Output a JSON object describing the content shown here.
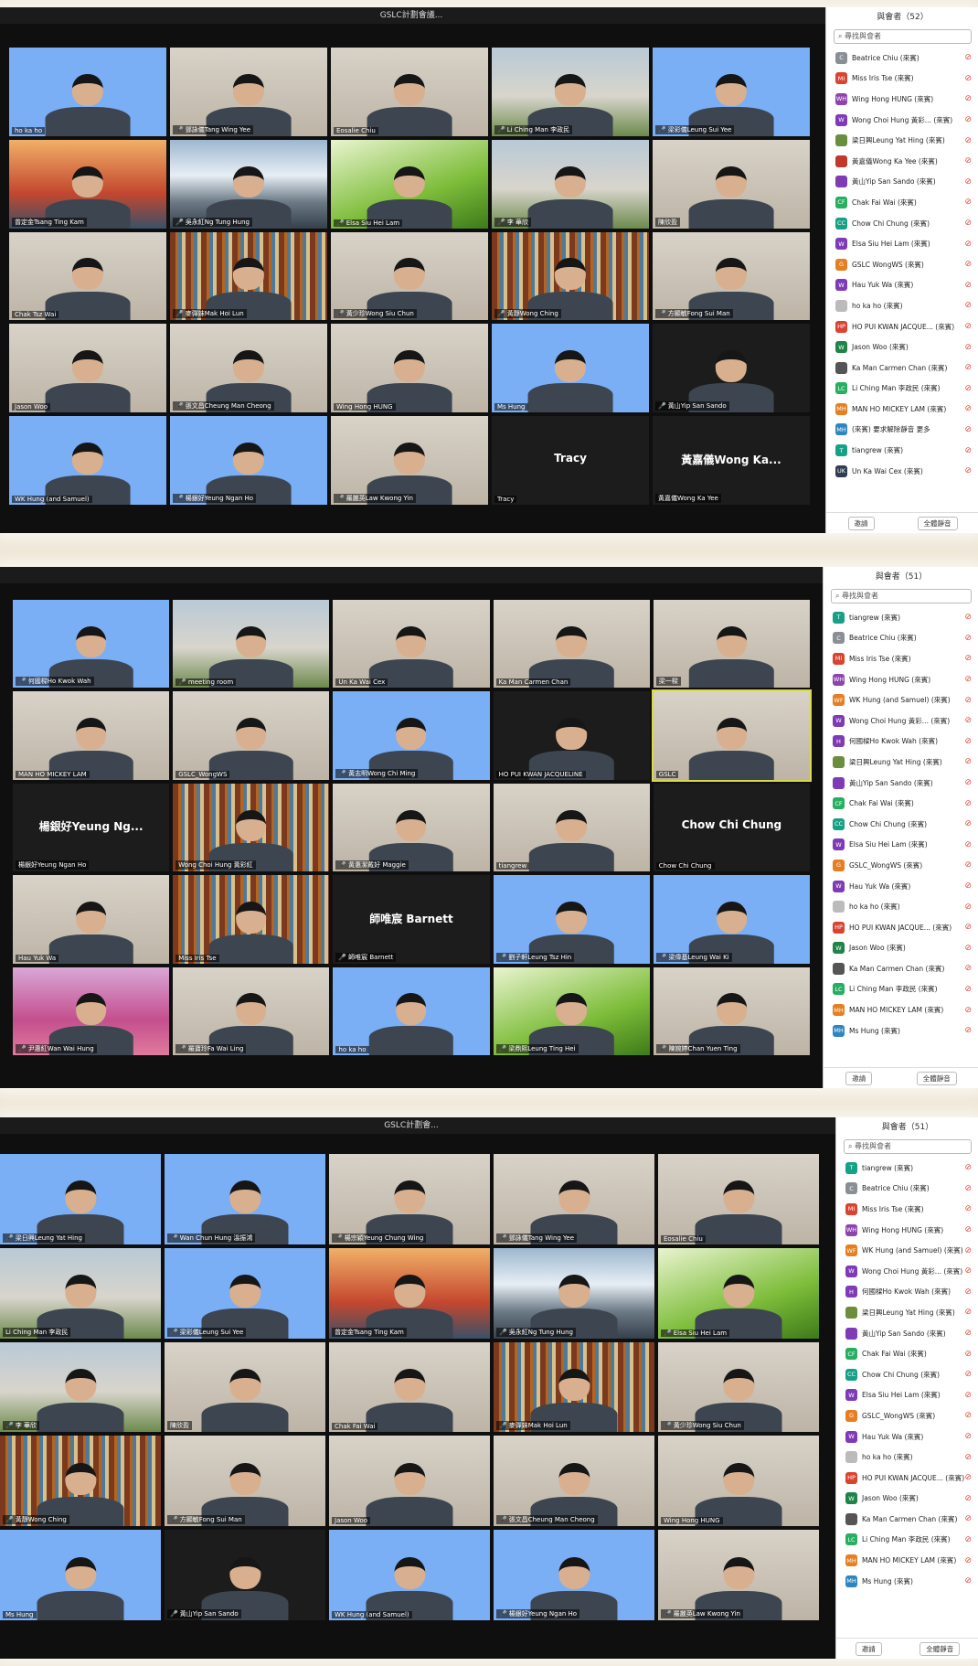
{
  "screens": [
    {
      "window_title": "GSLC計劃會議...",
      "toolbar_label": "",
      "participants_count_title": "與會者（52）",
      "search_placeholder": "尋找與會者",
      "footer": [
        "邀請",
        "全體靜音"
      ],
      "tiles": [
        {
          "name": "ho ka ho",
          "bg": "blue",
          "muted": false
        },
        {
          "name": "鄧詠儀Tang Wing Yee",
          "bg": "room",
          "muted": true
        },
        {
          "name": "Eosalie Chiu",
          "bg": "room",
          "muted": false
        },
        {
          "name": "Li Ching Man 李政民",
          "bg": "city",
          "muted": true
        },
        {
          "name": "梁彩儀Leung Sui Yee",
          "bg": "blue",
          "muted": true
        },
        {
          "name": "曾定金Tsang Ting Kam",
          "bg": "bridge",
          "muted": false
        },
        {
          "name": "吳永紅Ng Tung Hung",
          "bg": "mount",
          "muted": true
        },
        {
          "name": "Elsa Siu Hei Lam",
          "bg": "grass",
          "muted": true
        },
        {
          "name": "李 華欣",
          "bg": "city",
          "muted": true
        },
        {
          "name": "陳欣盈",
          "bg": "room",
          "muted": false
        },
        {
          "name": "Chak Tsz Wai",
          "bg": "room",
          "muted": false
        },
        {
          "name": "麥彈妹Mak Hoi Lun",
          "bg": "book",
          "muted": true
        },
        {
          "name": "黃少珍Wong Siu Chun",
          "bg": "room",
          "muted": true
        },
        {
          "name": "黃靜Wong Ching",
          "bg": "book",
          "muted": true
        },
        {
          "name": "方顯敏Fong Sui Man",
          "bg": "room",
          "muted": true
        },
        {
          "name": "Jason Woo",
          "bg": "room",
          "muted": false
        },
        {
          "name": "張文昌Cheung Man Cheong",
          "bg": "room",
          "muted": true
        },
        {
          "name": "Wing Hong HUNG",
          "bg": "room",
          "muted": false
        },
        {
          "name": "Ms Hung",
          "bg": "blue",
          "muted": false
        },
        {
          "name": "黃山Yip San Sando",
          "bg": "dark",
          "muted": true
        },
        {
          "name": "WK Hung (and Samuel)",
          "bg": "blue",
          "muted": false
        },
        {
          "name": "楊銀好Yeung Ngan Ho",
          "bg": "blue",
          "muted": true
        },
        {
          "name": "羅麗英Law Kwong Yin",
          "bg": "room",
          "muted": true
        },
        {
          "name": "Tracy",
          "bg": "dark",
          "muted": false,
          "big": "Tracy"
        },
        {
          "name": "黃嘉儀Wong Ka Yee",
          "bg": "dark",
          "muted": false,
          "big": "黃嘉儀Wong  Ka..."
        }
      ],
      "participants": [
        {
          "init": "C",
          "color": "#8a8f96",
          "name": "Beatrice Chiu (來賓)"
        },
        {
          "init": "MI",
          "color": "#d9432f",
          "name": "Miss Iris Tse (來賓)"
        },
        {
          "init": "WH",
          "color": "#8e44ad",
          "name": "Wing Hong HUNG (來賓)"
        },
        {
          "init": "W",
          "color": "#7e3bb5",
          "name": "Wong Choi Hung 黃彩... (來賓)"
        },
        {
          "init": "",
          "color": "#6b8e3c",
          "name": "梁日興Leung Yat Hing (來賓)"
        },
        {
          "init": "",
          "color": "#c0392b",
          "name": "黃嘉儀Wong Ka Yee (來賓)"
        },
        {
          "init": "",
          "color": "#7e3bb5",
          "name": "黃山Yip San Sando (來賓)"
        },
        {
          "init": "CF",
          "color": "#27ae60",
          "name": "Chak Fai Wai (來賓)"
        },
        {
          "init": "CC",
          "color": "#16a085",
          "name": "Chow Chi Chung (來賓)"
        },
        {
          "init": "W",
          "color": "#7e3bb5",
          "name": "Elsa Siu Hei Lam (來賓)"
        },
        {
          "init": "G",
          "color": "#e67e22",
          "name": "GSLC WongWS (來賓)"
        },
        {
          "init": "W",
          "color": "#7e3bb5",
          "name": "Hau Yuk Wa (來賓)"
        },
        {
          "init": "",
          "color": "#bbbbbb",
          "name": "ho ka ho (來賓)"
        },
        {
          "init": "HP",
          "color": "#d9432f",
          "name": "HO PUI KWAN JACQUE... (來賓)"
        },
        {
          "init": "W",
          "color": "#1e8449",
          "name": "Jason Woo (來賓)"
        },
        {
          "init": "",
          "color": "#555555",
          "name": "Ka Man Carmen Chan (來賓)"
        },
        {
          "init": "LC",
          "color": "#27ae60",
          "name": "Li Ching Man 李政民 (來賓)"
        },
        {
          "init": "MH",
          "color": "#e67e22",
          "name": "MAN HO MICKEY LAM (來賓)"
        },
        {
          "init": "MH",
          "color": "#2e86c1",
          "name": "(來賓)  要求解除靜音  更多"
        },
        {
          "init": "T",
          "color": "#16a085",
          "name": "tiangrew (來賓)"
        },
        {
          "init": "UK",
          "color": "#2c3e50",
          "name": "Un Ka Wai Cex (來賓)"
        }
      ]
    },
    {
      "window_title": "",
      "toolbar_label": "",
      "participants_count_title": "與會者（51）",
      "search_placeholder": "尋找與會者",
      "footer": [
        "邀請",
        "全體靜音"
      ],
      "tiles": [
        {
          "name": "何國樑Ho Kwok Wah",
          "bg": "blue",
          "muted": true
        },
        {
          "name": "meeting room",
          "bg": "city",
          "muted": true
        },
        {
          "name": "Un Ka Wai Cex",
          "bg": "room",
          "muted": false
        },
        {
          "name": "Ka Man Carmen Chan",
          "bg": "room",
          "muted": false
        },
        {
          "name": "梁一樑",
          "bg": "room",
          "muted": false
        },
        {
          "name": "MAN HO MICKEY LAM",
          "bg": "room",
          "muted": false
        },
        {
          "name": "GSLC_WongWS",
          "bg": "room",
          "muted": false
        },
        {
          "name": "黃志明Wong Chi Ming",
          "bg": "blue",
          "muted": true
        },
        {
          "name": "HO PUI KWAN JACQUELINE",
          "bg": "dark",
          "muted": false
        },
        {
          "name": "GSLC",
          "bg": "room",
          "muted": false,
          "sel": true
        },
        {
          "name": "楊銀好Yeung Ngan Ho",
          "bg": "dark",
          "muted": false,
          "big": "楊銀好Yeung  Ng..."
        },
        {
          "name": "Wong Choi Hung 黃彩紅",
          "bg": "book",
          "muted": false
        },
        {
          "name": "黃惠潔戴好 Maggie",
          "bg": "room",
          "muted": true
        },
        {
          "name": "tiangrew",
          "bg": "room",
          "muted": false
        },
        {
          "name": "Chow Chi Chung",
          "bg": "dark",
          "muted": false,
          "big": "Chow Chi Chung"
        },
        {
          "name": "Hau Yuk Wa",
          "bg": "room",
          "muted": false
        },
        {
          "name": "Miss Iris Tse",
          "bg": "book",
          "muted": false
        },
        {
          "name": "師唯宸 Barnett",
          "bg": "dark",
          "muted": true,
          "big": "師唯宸  Barnett"
        },
        {
          "name": "劉子軒Leung Tsz Hin",
          "bg": "blue",
          "muted": true
        },
        {
          "name": "梁偉基Leung Wai Ki",
          "bg": "blue",
          "muted": true
        },
        {
          "name": "尹惠紅Wan Wai Hung",
          "bg": "pink",
          "muted": true
        },
        {
          "name": "羅寶玲Fa Wai Ling",
          "bg": "room",
          "muted": true
        },
        {
          "name": "ho ka ho",
          "bg": "blue",
          "muted": false
        },
        {
          "name": "梁鼎熙Leung Ting Hei",
          "bg": "grass",
          "muted": true
        },
        {
          "name": "陳婉婷Chan Yuen Ting",
          "bg": "room",
          "muted": true
        }
      ],
      "participants": [
        {
          "init": "T",
          "color": "#16a085",
          "name": "tiangrew (來賓)"
        },
        {
          "init": "C",
          "color": "#8a8f96",
          "name": "Beatrice Chiu (來賓)"
        },
        {
          "init": "MI",
          "color": "#d9432f",
          "name": "Miss Iris Tse (來賓)"
        },
        {
          "init": "WH",
          "color": "#8e44ad",
          "name": "Wing Hong HUNG (來賓)"
        },
        {
          "init": "WF",
          "color": "#e67e22",
          "name": "WK Hung (and Samuel) (來賓)"
        },
        {
          "init": "W",
          "color": "#7e3bb5",
          "name": "Wong Choi Hung 黃彩... (來賓)"
        },
        {
          "init": "H",
          "color": "#7e3bb5",
          "name": "何國樑Ho Kwok Wah (來賓)"
        },
        {
          "init": "",
          "color": "#6b8e3c",
          "name": "梁日興Leung Yat Hing (來賓)"
        },
        {
          "init": "",
          "color": "#7e3bb5",
          "name": "黃山Yip San Sando (來賓)"
        },
        {
          "init": "CF",
          "color": "#27ae60",
          "name": "Chak Fai Wai (來賓)"
        },
        {
          "init": "CC",
          "color": "#16a085",
          "name": "Chow Chi Chung (來賓)"
        },
        {
          "init": "W",
          "color": "#7e3bb5",
          "name": "Elsa Siu Hei Lam (來賓)"
        },
        {
          "init": "G",
          "color": "#e67e22",
          "name": "GSLC_WongWS (來賓)"
        },
        {
          "init": "W",
          "color": "#7e3bb5",
          "name": "Hau Yuk Wa (來賓)"
        },
        {
          "init": "",
          "color": "#bbbbbb",
          "name": "ho ka ho (來賓)"
        },
        {
          "init": "HP",
          "color": "#d9432f",
          "name": "HO PUI KWAN JACQUE... (來賓)"
        },
        {
          "init": "W",
          "color": "#1e8449",
          "name": "Jason Woo (來賓)"
        },
        {
          "init": "",
          "color": "#555555",
          "name": "Ka Man Carmen Chan (來賓)"
        },
        {
          "init": "LC",
          "color": "#27ae60",
          "name": "Li Ching Man 李政民 (來賓)"
        },
        {
          "init": "MH",
          "color": "#e67e22",
          "name": "MAN HO MICKEY LAM (來賓)"
        },
        {
          "init": "MH",
          "color": "#2e86c1",
          "name": "Ms Hung (來賓)"
        }
      ]
    },
    {
      "window_title": "GSLC計劃會...",
      "toolbar_label": "",
      "participants_count_title": "與會者（51）",
      "search_placeholder": "尋找與會者",
      "footer": [
        "邀請",
        "全體靜音"
      ],
      "tiles": [
        {
          "name": "梁日興Leung Yat Hing",
          "bg": "blue",
          "muted": true
        },
        {
          "name": "Wan Chun Hung 溫振鴻",
          "bg": "blue",
          "muted": true
        },
        {
          "name": "楊宗穎Yeung Chung Wing",
          "bg": "room",
          "muted": true
        },
        {
          "name": "鄧詠儀Tang Wing Yee",
          "bg": "room",
          "muted": true
        },
        {
          "name": "Eosalie Chiu",
          "bg": "room",
          "muted": false
        },
        {
          "name": "Li Ching Man 李政民",
          "bg": "city",
          "muted": false
        },
        {
          "name": "梁彩儀Leung Sui Yee",
          "bg": "blue",
          "muted": true
        },
        {
          "name": "曾定金Tsang Ting Kam",
          "bg": "bridge",
          "muted": false
        },
        {
          "name": "吳永紅Ng Tung Hung",
          "bg": "mount",
          "muted": true
        },
        {
          "name": "Elsa Siu Hei Lam",
          "bg": "grass",
          "muted": true
        },
        {
          "name": "李 華欣",
          "bg": "city",
          "muted": true
        },
        {
          "name": "陳欣盈",
          "bg": "room",
          "muted": false
        },
        {
          "name": "Chak Fai Wai",
          "bg": "room",
          "muted": false
        },
        {
          "name": "麥彈妹Mak Hoi Lun",
          "bg": "book",
          "muted": true
        },
        {
          "name": "黃少珍Wong Siu Chun",
          "bg": "room",
          "muted": true
        },
        {
          "name": "黃靜Wong Ching",
          "bg": "book",
          "muted": true
        },
        {
          "name": "方顯敏Fong Sui Man",
          "bg": "room",
          "muted": true
        },
        {
          "name": "Jason Woo",
          "bg": "room",
          "muted": false
        },
        {
          "name": "張文昌Cheung Man Cheong",
          "bg": "room",
          "muted": true
        },
        {
          "name": "Wing Hong HUNG",
          "bg": "room",
          "muted": false
        },
        {
          "name": "Ms Hung",
          "bg": "blue",
          "muted": false
        },
        {
          "name": "黃山Yip San Sando",
          "bg": "dark",
          "muted": true
        },
        {
          "name": "WK Hung (and Samuel)",
          "bg": "blue",
          "muted": false
        },
        {
          "name": "楊銀好Yeung Ngan Ho",
          "bg": "blue",
          "muted": true
        },
        {
          "name": "羅麗英Law Kwong Yin",
          "bg": "room",
          "muted": true
        }
      ],
      "participants": [
        {
          "init": "T",
          "color": "#16a085",
          "name": "tiangrew (來賓)"
        },
        {
          "init": "C",
          "color": "#8a8f96",
          "name": "Beatrice Chiu (來賓)"
        },
        {
          "init": "MI",
          "color": "#d9432f",
          "name": "Miss Iris Tse (來賓)"
        },
        {
          "init": "WH",
          "color": "#8e44ad",
          "name": "Wing Hong HUNG (來賓)"
        },
        {
          "init": "WF",
          "color": "#e67e22",
          "name": "WK Hung (and Samuel) (來賓)"
        },
        {
          "init": "W",
          "color": "#7e3bb5",
          "name": "Wong Choi Hung 黃彩... (來賓)"
        },
        {
          "init": "H",
          "color": "#7e3bb5",
          "name": "何國樑Ho Kwok Wah (來賓)"
        },
        {
          "init": "",
          "color": "#6b8e3c",
          "name": "梁日興Leung Yat Hing (來賓)"
        },
        {
          "init": "",
          "color": "#7e3bb5",
          "name": "黃山Yip San Sando (來賓)"
        },
        {
          "init": "CF",
          "color": "#27ae60",
          "name": "Chak Fai Wai (來賓)"
        },
        {
          "init": "CC",
          "color": "#16a085",
          "name": "Chow Chi Chung (來賓)"
        },
        {
          "init": "W",
          "color": "#7e3bb5",
          "name": "Elsa Siu Hei Lam (來賓)"
        },
        {
          "init": "G",
          "color": "#e67e22",
          "name": "GSLC_WongWS (來賓)"
        },
        {
          "init": "W",
          "color": "#7e3bb5",
          "name": "Hau Yuk Wa (來賓)"
        },
        {
          "init": "",
          "color": "#bbbbbb",
          "name": "ho ka ho (來賓)"
        },
        {
          "init": "HP",
          "color": "#d9432f",
          "name": "HO PUI KWAN JACQUE... (來賓)"
        },
        {
          "init": "W",
          "color": "#1e8449",
          "name": "Jason Woo (來賓)"
        },
        {
          "init": "",
          "color": "#555555",
          "name": "Ka Man Carmen Chan (來賓)"
        },
        {
          "init": "LC",
          "color": "#27ae60",
          "name": "Li Ching Man 李政民 (來賓)"
        },
        {
          "init": "MH",
          "color": "#e67e22",
          "name": "MAN HO MICKEY LAM (來賓)"
        },
        {
          "init": "MH",
          "color": "#2e86c1",
          "name": "Ms Hung (來賓)"
        }
      ]
    }
  ],
  "colors": {
    "tile_bg": "#1f1f1f",
    "virtual_blue": "#7aaef5",
    "muted_red": "#e2483d",
    "active_speaker": "#d9d94a"
  }
}
